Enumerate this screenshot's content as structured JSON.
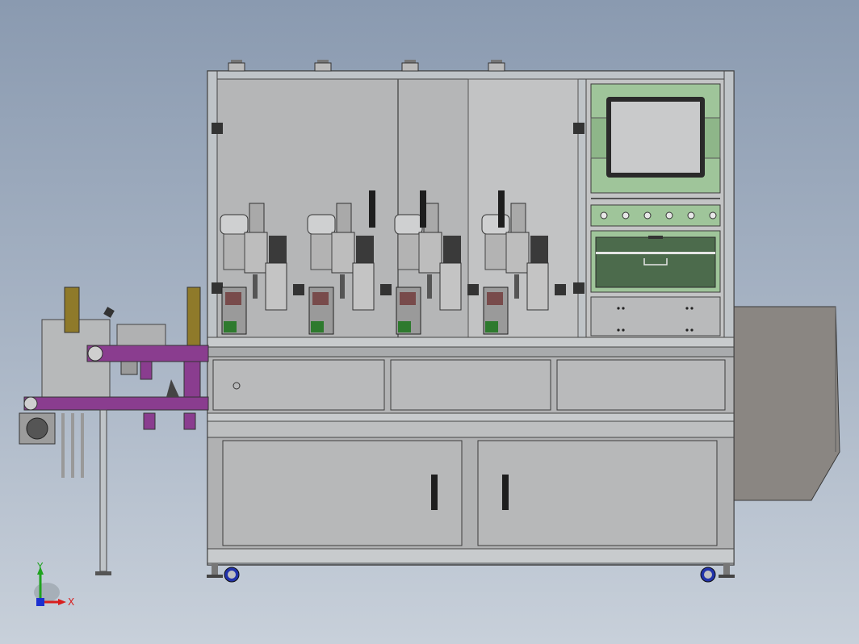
{
  "view": {
    "background_top": "#8a9ab0",
    "background_bottom": "#c8d0da"
  },
  "triad": {
    "x_label": "X",
    "y_label": "Y",
    "x_color": "#d81e1e",
    "y_color": "#1fa31f",
    "z_color": "#1c2fd0"
  },
  "colors": {
    "frame": "#bfc4c8",
    "panel": "#b7b9ba",
    "panel_dark": "#8d8d8d",
    "hmi_green": "#9fc59a",
    "drawer_green": "#4c6b4c",
    "purple_rail": "#8a3d8f",
    "olive_post": "#8f7a2a",
    "side_chute": "#8a8682",
    "wheel_blue": "#2233aa"
  },
  "stations": [
    {
      "name": "station-1"
    },
    {
      "name": "station-2"
    },
    {
      "name": "station-3"
    },
    {
      "name": "station-4"
    }
  ],
  "control_panel": {
    "indicator_count": 6
  },
  "doors": [
    {
      "name": "lower-door-left"
    },
    {
      "name": "lower-door-right"
    }
  ],
  "mid_drawers": [
    {
      "name": "drawer-left"
    },
    {
      "name": "drawer-center"
    },
    {
      "name": "drawer-right"
    }
  ]
}
